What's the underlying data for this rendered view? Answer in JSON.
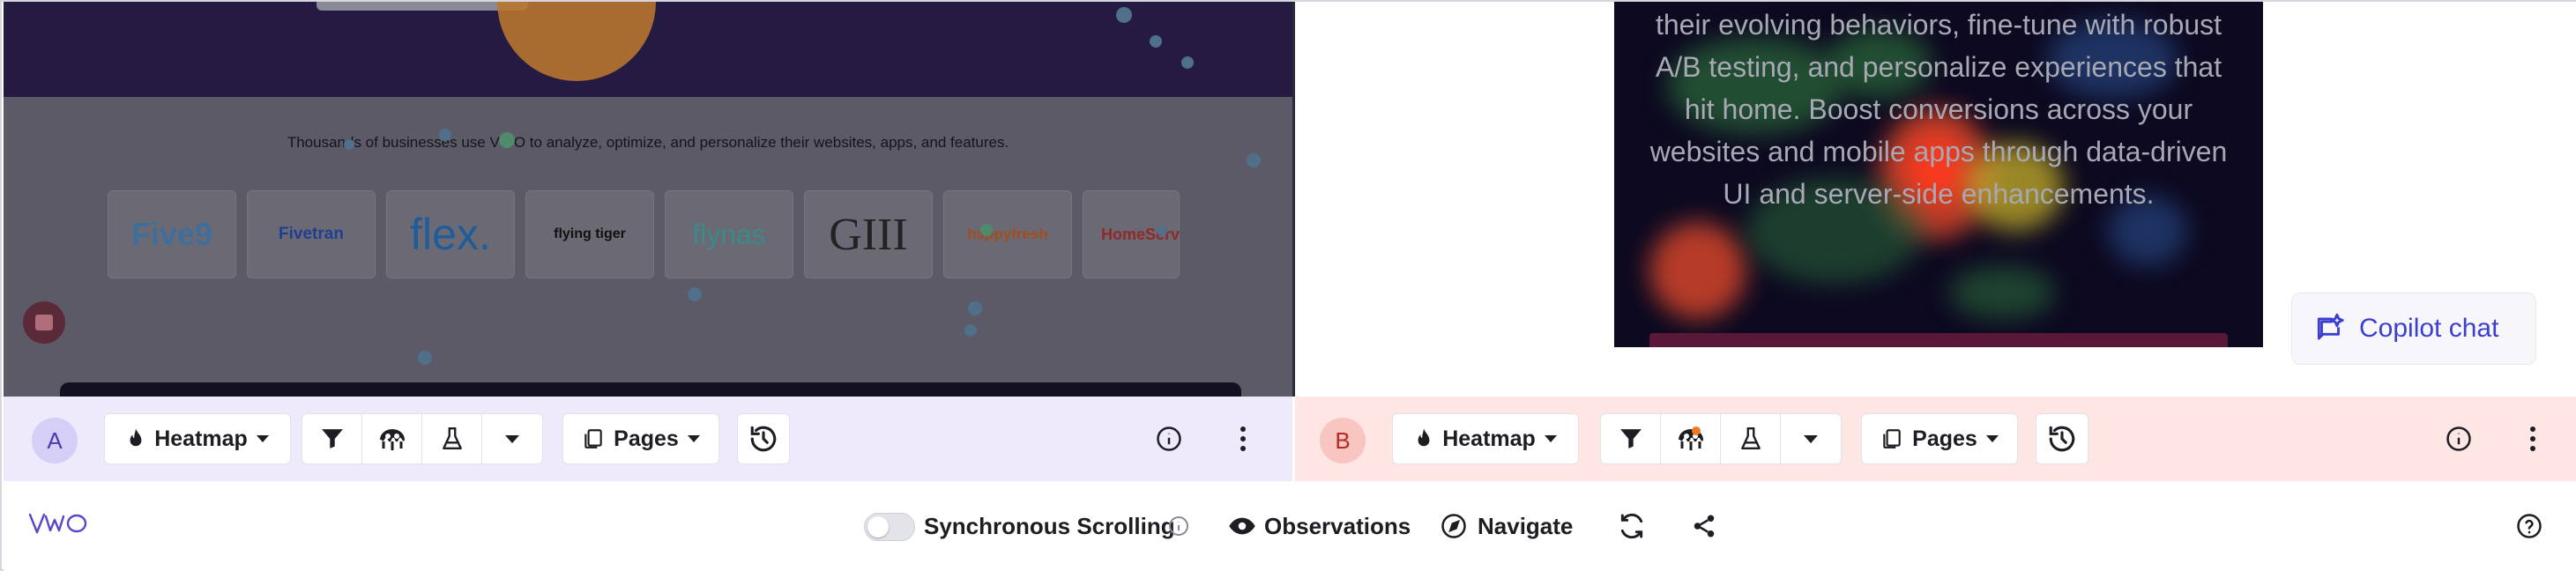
{
  "pane_a": {
    "tagline": "Thousands of businesses use VWO to analyze, optimize, and personalize their websites, apps, and features.",
    "logos": [
      "Five9",
      "Fivetran",
      "flex.",
      "flying tiger",
      "flynas",
      "GIII",
      "happyfresh",
      "HomeServ"
    ]
  },
  "pane_b": {
    "paragraph": "their evolving behaviors, fine-tune with robust A/B testing, and personalize experiences that hit home. Boost conversions across your websites and mobile apps through data-driven UI and server-side enhancements.",
    "copilot_label": "Copilot chat"
  },
  "control_a": {
    "badge": "A",
    "mode_label": "Heatmap",
    "pages_label": "Pages"
  },
  "control_b": {
    "badge": "B",
    "mode_label": "Heatmap",
    "pages_label": "Pages"
  },
  "footer": {
    "brand": "VWO",
    "sync_label": "Synchronous Scrolling",
    "sync_enabled": false,
    "observations_label": "Observations",
    "navigate_label": "Navigate"
  },
  "colors": {
    "accent_purple": "#5b46c9",
    "pane_a_tint": "#eeeafc",
    "pane_b_tint": "#fde6e4",
    "copilot_blue": "#3b3fd0"
  }
}
